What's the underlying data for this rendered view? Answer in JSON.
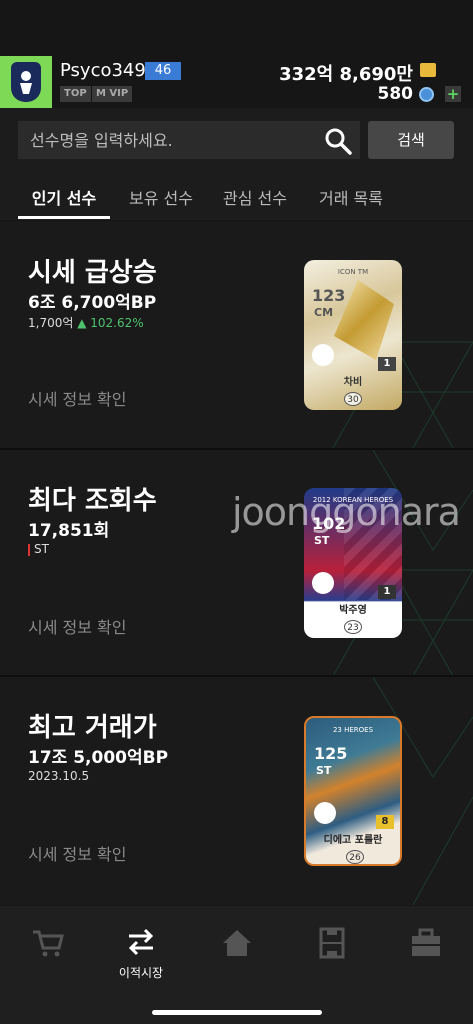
{
  "header": {
    "username": "Psyco349",
    "level": "46",
    "badges": [
      "TOP",
      "M VIP"
    ],
    "bp_amount": "332억 8,690만",
    "fc_amount": "580",
    "plus_label": "+"
  },
  "search": {
    "placeholder": "선수명을 입력하세요.",
    "button_label": "검색"
  },
  "tabs": [
    {
      "label": "인기 선수",
      "active": true
    },
    {
      "label": "보유 선수",
      "active": false
    },
    {
      "label": "관심 선수",
      "active": false
    },
    {
      "label": "거래 목록",
      "active": false
    }
  ],
  "sections": [
    {
      "title": "시세 급상승",
      "value": "6조 6,700억BP",
      "sub_base": "1,700억",
      "sub_change": "▲ 102.62%",
      "link": "시세 정보 확인",
      "card": {
        "season": "ICON TM",
        "ovr": "123",
        "pos": "CM",
        "grade": "1",
        "name": "차비",
        "pay": "30"
      }
    },
    {
      "title": "최다 조회수",
      "value": "17,851회",
      "sub": "ST",
      "link": "시세 정보 확인",
      "card": {
        "season": "2012 KOREAN HEROES",
        "ovr": "102",
        "pos": "ST",
        "grade": "1",
        "name": "박주영",
        "pay": "23"
      }
    },
    {
      "title": "최고 거래가",
      "value": "17조 5,000억BP",
      "sub": "2023.10.5",
      "link": "시세 정보 확인",
      "card": {
        "season": "23 HEROES",
        "ovr": "125",
        "pos": "ST",
        "grade": "8",
        "name": "디에고 포를란",
        "pay": "26"
      }
    }
  ],
  "watermark": "joonggonara",
  "bottom_nav": [
    {
      "icon": "cart-icon",
      "label": ""
    },
    {
      "icon": "transfer-icon",
      "label": "이적시장"
    },
    {
      "icon": "home-icon",
      "label": ""
    },
    {
      "icon": "pitch-icon",
      "label": ""
    },
    {
      "icon": "briefcase-icon",
      "label": ""
    }
  ]
}
